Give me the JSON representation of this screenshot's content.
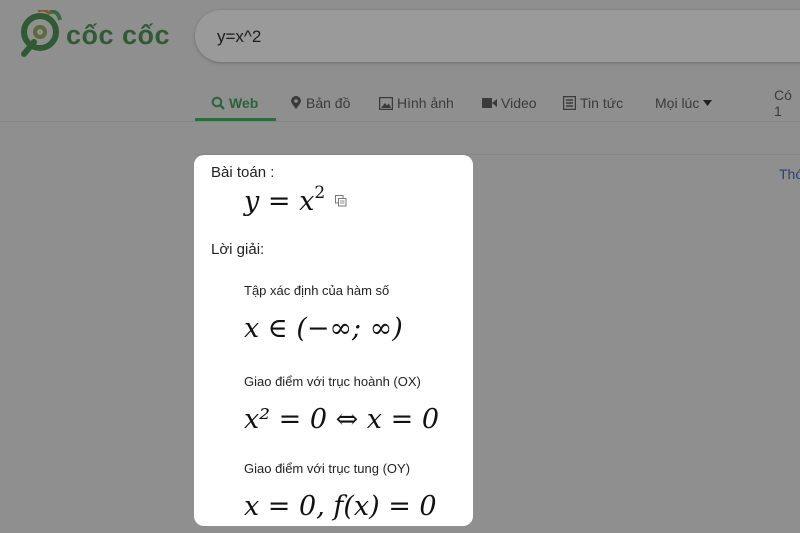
{
  "header": {
    "logo_text": "cốc cốc",
    "search_value": "y=x^2"
  },
  "tabs": [
    {
      "label": "Web",
      "icon": "search-icon",
      "active": true
    },
    {
      "label": "Bản đồ",
      "icon": "map-pin-icon"
    },
    {
      "label": "Hình ảnh",
      "icon": "image-icon"
    },
    {
      "label": "Video",
      "icon": "video-icon"
    },
    {
      "label": "Tin tức",
      "icon": "news-icon"
    },
    {
      "label": "Mọi lúc",
      "icon": "caret-down-icon"
    },
    {
      "label": "Có 1"
    }
  ],
  "side_link": "Thó",
  "card": {
    "problem_label": "Bài toán :",
    "problem": {
      "lhs": "y",
      "rel": "=",
      "base": "x",
      "exp": "2"
    },
    "solution_label": "Lời giải:",
    "steps": [
      {
        "title": "Tập xác định của hàm số",
        "formula": "x ∈ (−∞; ∞)"
      },
      {
        "title": "Giao điểm với trục hoành (OX)",
        "formula": "x² = 0 ⇔ x = 0"
      },
      {
        "title": "Giao điểm với trục tung (OY)",
        "formula": "x = 0,   f(x) = 0"
      }
    ]
  },
  "colors": {
    "brand_green": "#2f5a34",
    "active_tab": "#27643a",
    "overlay_bg": "#8f8f8f"
  }
}
